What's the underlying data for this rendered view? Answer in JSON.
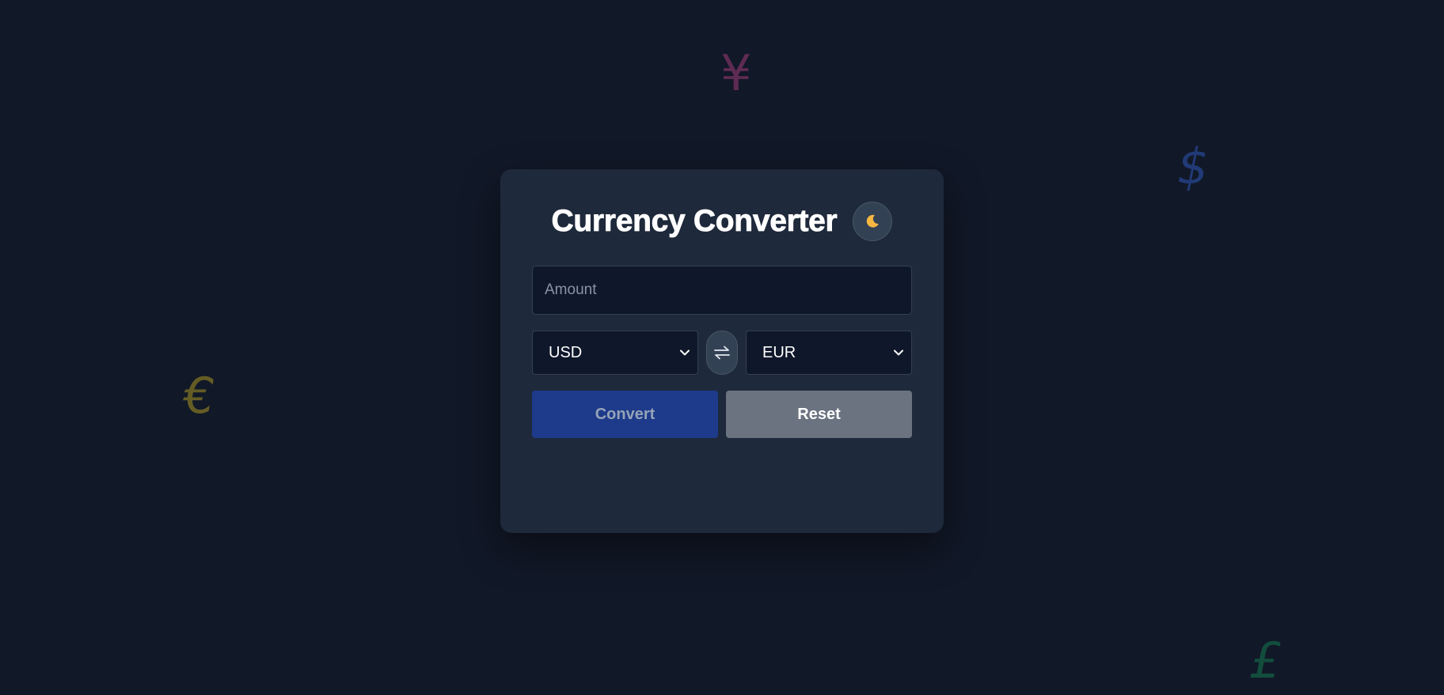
{
  "background_symbols": {
    "yen": "¥",
    "dollar": "$",
    "euro": "€",
    "pound": "£"
  },
  "converter": {
    "title": "Currency Converter",
    "theme_toggle_icon": "moon-icon",
    "amount": {
      "placeholder": "Amount",
      "value": ""
    },
    "from_currency": "USD",
    "to_currency": "EUR",
    "swap_icon": "swap-arrows-icon",
    "convert_label": "Convert",
    "reset_label": "Reset"
  },
  "colors": {
    "background": "#111827",
    "card": "#1e293b",
    "convert_button": "#1e3a8a",
    "reset_button": "#6b7280",
    "moon": "#f5b642"
  }
}
